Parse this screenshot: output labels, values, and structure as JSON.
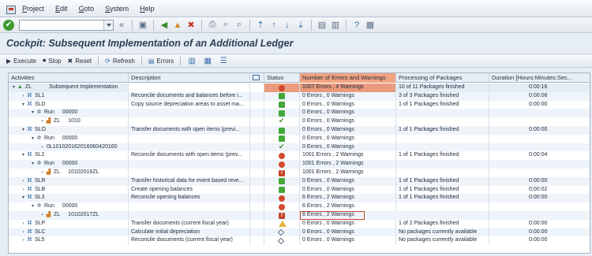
{
  "menu": {
    "items": [
      "Project",
      "Edit",
      "Goto",
      "System",
      "Help"
    ]
  },
  "title": "Cockpit: Subsequent Implementation of an Additional Ledger",
  "appbar": {
    "execute": "Execute",
    "stop": "Stop",
    "reset": "Reset",
    "refresh": "Refresh",
    "errors": "Errors"
  },
  "columns": {
    "activities": "Activities",
    "description": "Description",
    "status": "Status",
    "errors": "Number of Errors and Warnings",
    "processing": "Processing of Packages",
    "duration": "Duration [Hours:Minutes:Sec..."
  },
  "rows": [
    {
      "t": "▾",
      "lvl": 0,
      "icon": "tri",
      "id": "ZL",
      "desc": "Subsequent Implementation",
      "desc2": "",
      "status": "red",
      "err": "1007 Errors , 4 Warnings",
      "proc": "10 of 11 Packages finished",
      "dur": "0:00:16",
      "hl": true
    },
    {
      "t": "›",
      "lvl": 1,
      "icon": "cube",
      "id": "SL1",
      "desc": "",
      "desc2": "Reconcile documents and balances before i...",
      "status": "green",
      "err": "0 Errors , 0 Warnings",
      "proc": "3 of 3 Packages finished",
      "dur": "0:00:08"
    },
    {
      "t": "▾",
      "lvl": 1,
      "icon": "cube",
      "id": "SLD",
      "desc": "",
      "desc2": "Copy source depreciation areas to asset ma...",
      "status": "green",
      "err": "0 Errors , 0 Warnings",
      "proc": "1 of 1 Packages finished",
      "dur": "0:00:00"
    },
    {
      "t": "▾",
      "lvl": 2,
      "icon": "gear",
      "id": "Run",
      "desc": "00000",
      "desc2": "",
      "status": "green",
      "err": "0 Errors , 0 Warnings",
      "proc": "",
      "dur": ""
    },
    {
      "t": "•",
      "lvl": 3,
      "icon": "chart",
      "id": "ZL",
      "desc": "1010",
      "desc2": "",
      "status": "check",
      "err": "0 Errors , 0 Warnings",
      "proc": "",
      "dur": ""
    },
    {
      "t": "▾",
      "lvl": 1,
      "icon": "cube",
      "id": "SLO",
      "desc": "",
      "desc2": "Transfer documents with open items (previ...",
      "status": "green",
      "err": "0 Errors , 0 Warnings",
      "proc": "1 of 1 Packages finished",
      "dur": "0:00:00"
    },
    {
      "t": "▾",
      "lvl": 2,
      "icon": "gear",
      "id": "Run",
      "desc": "00000",
      "desc2": "",
      "status": "green",
      "err": "0 Errors , 0 Warnings",
      "proc": "",
      "dur": ""
    },
    {
      "t": "•",
      "lvl": 3,
      "icon": "",
      "id": "0L101020162016060420160",
      "desc": "",
      "desc2": "",
      "status": "check",
      "err": "0 Errors , 0 Warnings",
      "proc": "",
      "dur": ""
    },
    {
      "t": "▾",
      "lvl": 1,
      "icon": "cube",
      "id": "SL2",
      "desc": "",
      "desc2": "Reconcile documents with open items (prev...",
      "status": "red",
      "err": "1001 Errors , 2 Warnings",
      "proc": "1 of 1 Packages finished",
      "dur": "0:00:04"
    },
    {
      "t": "▾",
      "lvl": 2,
      "icon": "gear",
      "id": "Run",
      "desc": "00000",
      "desc2": "",
      "status": "red",
      "err": "1001 Errors , 2 Warnings",
      "proc": "",
      "dur": ""
    },
    {
      "t": "•",
      "lvl": 3,
      "icon": "chart",
      "id": "ZL",
      "desc": "10102016ZL",
      "desc2": "",
      "status": "red2",
      "err": "1001 Errors , 2 Warnings",
      "proc": "",
      "dur": ""
    },
    {
      "t": "›",
      "lvl": 1,
      "icon": "cube",
      "id": "SLR",
      "desc": "",
      "desc2": "Transfer historical data for event based reve...",
      "status": "green",
      "err": "0 Errors , 0 Warnings",
      "proc": "1 of 1 Packages finished",
      "dur": "0:00:00"
    },
    {
      "t": "›",
      "lvl": 1,
      "icon": "cube",
      "id": "SLB",
      "desc": "",
      "desc2": "Create opening balances",
      "status": "green",
      "err": "0 Errors , 0 Warnings",
      "proc": "1 of 1 Packages finished",
      "dur": "0:00:02"
    },
    {
      "t": "▾",
      "lvl": 1,
      "icon": "cube",
      "id": "SL3",
      "desc": "",
      "desc2": "Reconcile opening balances",
      "status": "red",
      "err": "6 Errors , 2 Warnings",
      "proc": "1 of 1 Packages finished",
      "dur": "0:00:00"
    },
    {
      "t": "▾",
      "lvl": 2,
      "icon": "gear",
      "id": "Run",
      "desc": "00000",
      "desc2": "",
      "status": "red",
      "err": "6 Errors , 2 Warnings",
      "proc": "",
      "dur": ""
    },
    {
      "t": "•",
      "lvl": 3,
      "icon": "chart",
      "id": "ZL",
      "desc": "10102017ZL",
      "desc2": "",
      "status": "red2",
      "err": "6 Errors , 2 Warnings",
      "proc": "",
      "dur": "",
      "box": true
    },
    {
      "t": "›",
      "lvl": 1,
      "icon": "cube",
      "id": "SLP",
      "desc": "",
      "desc2": "Transfer documents (current fiscal year)",
      "status": "warn",
      "err": "0 Errors , 0 Warnings",
      "proc": "1 of 2 Packages finished",
      "dur": "0:00:00"
    },
    {
      "t": "›",
      "lvl": 1,
      "icon": "cube",
      "id": "SLC",
      "desc": "",
      "desc2": "Calculate initial depreciation",
      "status": "diamond",
      "err": "0 Errors , 0 Warnings",
      "proc": "No packages currently available",
      "dur": "0:00:00"
    },
    {
      "t": "›",
      "lvl": 1,
      "icon": "cube",
      "id": "SL5",
      "desc": "",
      "desc2": "Reconcile documents (current fiscal year)",
      "status": "diamond",
      "err": "0 Errors , 0 Warnings",
      "proc": "No packages currently available",
      "dur": "0:00:00"
    }
  ]
}
